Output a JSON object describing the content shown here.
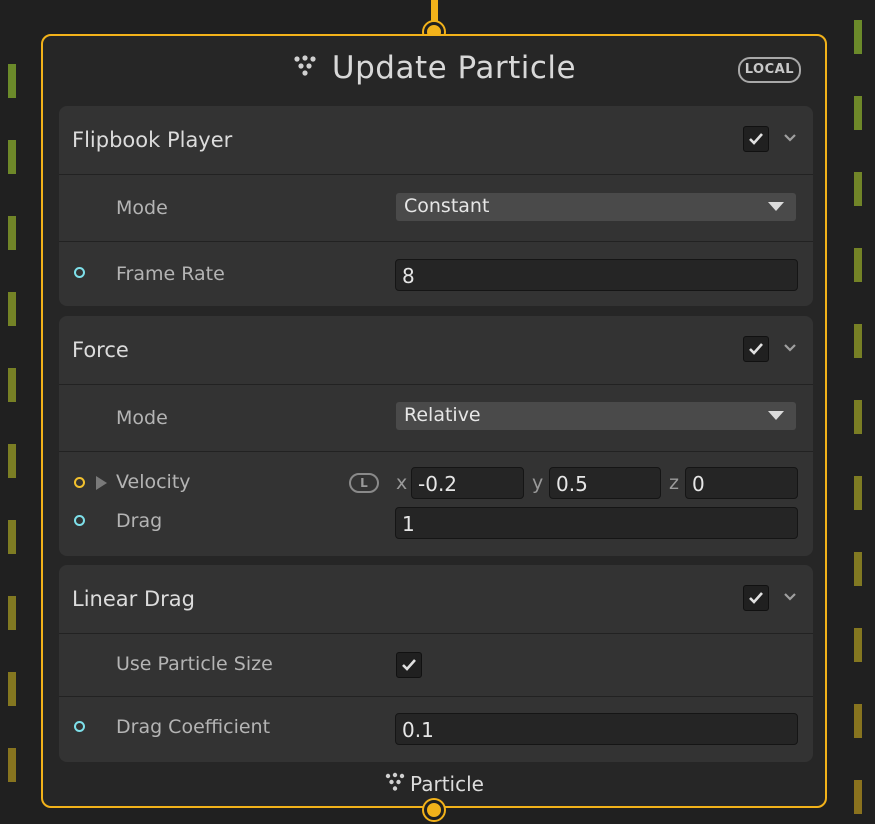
{
  "node": {
    "title": "Update Particle",
    "space_badge": "LOCAL",
    "icon": "particle-system-icon",
    "footer_label": "Particle",
    "accent_color": "#f2b21a"
  },
  "blocks": {
    "flipbook": {
      "title": "Flipbook Player",
      "enabled": true,
      "mode_label": "Mode",
      "mode_value": "Constant",
      "frame_rate_label": "Frame Rate",
      "frame_rate_value": "8"
    },
    "force": {
      "title": "Force",
      "enabled": true,
      "mode_label": "Mode",
      "mode_value": "Relative",
      "velocity_label": "Velocity",
      "velocity_space": "L",
      "x_label": "x",
      "y_label": "y",
      "z_label": "z",
      "velocity_x": "-0.2",
      "velocity_y": "0.5",
      "velocity_z": "0",
      "drag_label": "Drag",
      "drag_value": "1"
    },
    "linear_drag": {
      "title": "Linear Drag",
      "enabled": true,
      "use_size_label": "Use Particle Size",
      "use_size_checked": true,
      "coefficient_label": "Drag Coefficient",
      "coefficient_value": "0.1"
    }
  },
  "colors": {
    "float_slot": "#7ee0ea",
    "vector_slot": "#f2c12e"
  }
}
